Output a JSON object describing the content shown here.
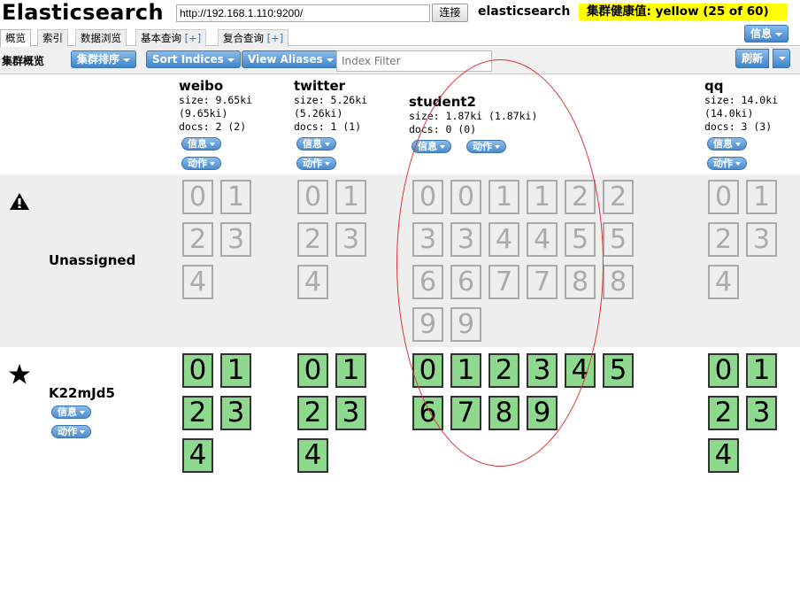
{
  "header": {
    "app_title": "Elasticsearch",
    "url": "http://192.168.1.110:9200/",
    "connect_label": "连接",
    "cluster_name": "elasticsearch",
    "health": "集群健康值: yellow (25 of 60)"
  },
  "tabs": [
    {
      "label": "概览",
      "plus": ""
    },
    {
      "label": "索引",
      "plus": ""
    },
    {
      "label": "数据浏览",
      "plus": ""
    },
    {
      "label": "基本查询",
      "plus": "[+]"
    },
    {
      "label": "复合查询",
      "plus": "[+]"
    }
  ],
  "info_top_label": "信息",
  "toolbar": {
    "title": "集群概览",
    "sort_cluster": "集群排序",
    "sort_indices": "Sort Indices",
    "view_aliases": "View Aliases",
    "index_filter_placeholder": "Index Filter",
    "refresh": "刷新"
  },
  "pill_labels": {
    "info": "信息",
    "action": "动作"
  },
  "indices": [
    {
      "name": "weibo",
      "size": "size: 9.65ki",
      "size2": "(9.65ki)",
      "docs": "docs: 2 (2)"
    },
    {
      "name": "twitter",
      "size": "size: 5.26ki",
      "size2": "(5.26ki)",
      "docs": "docs: 1 (1)"
    },
    {
      "name": "student2",
      "size": "size: 1.87ki (1.87ki)",
      "size2": "",
      "docs": "docs: 0 (0)"
    },
    {
      "name": "qq",
      "size": "size: 14.0ki",
      "size2": "(14.0ki)",
      "docs": "docs: 3 (3)"
    }
  ],
  "rows": {
    "unassigned_label": "Unassigned",
    "node_label": "K22mJd5"
  },
  "unassigned_shards": {
    "weibo": [
      "0",
      "1",
      "2",
      "3",
      "4"
    ],
    "twitter": [
      "0",
      "1",
      "2",
      "3",
      "4"
    ],
    "student2": [
      "0",
      "0",
      "1",
      "1",
      "2",
      "2",
      "3",
      "3",
      "4",
      "4",
      "5",
      "5",
      "6",
      "6",
      "7",
      "7",
      "8",
      "8",
      "9",
      "9"
    ],
    "qq": [
      "0",
      "1",
      "2",
      "3",
      "4"
    ]
  },
  "node_shards": {
    "weibo": [
      "0",
      "1",
      "2",
      "3",
      "4"
    ],
    "twitter": [
      "0",
      "1",
      "2",
      "3",
      "4"
    ],
    "student2": [
      "0",
      "1",
      "2",
      "3",
      "4",
      "5",
      "6",
      "7",
      "8",
      "9"
    ],
    "qq": [
      "0",
      "1",
      "2",
      "3",
      "4"
    ]
  },
  "colors": {
    "health_bg": "#ffff00",
    "assigned_shard": "#8fd98f",
    "button_blue": "#3f84c9",
    "annotation_circle": "#dd3333"
  }
}
